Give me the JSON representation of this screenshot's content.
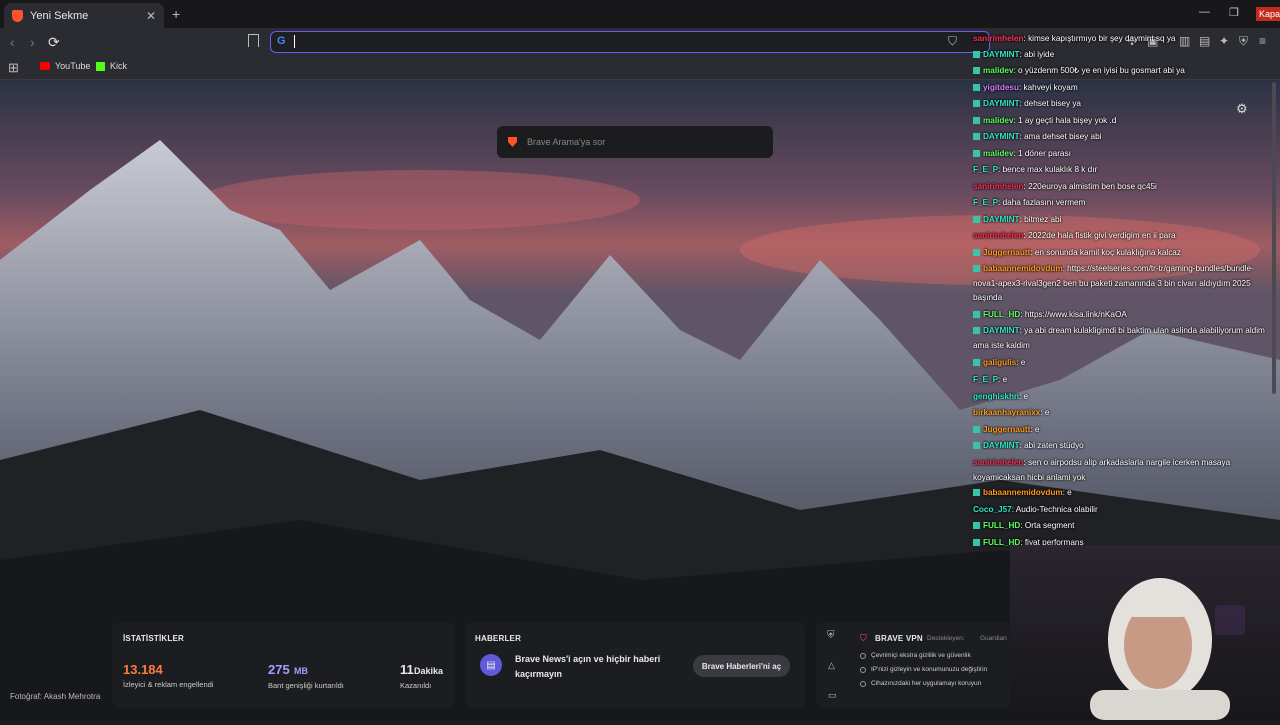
{
  "tab": {
    "title": "Yeni Sekme",
    "close": "✕",
    "new": "+"
  },
  "window": {
    "minimize": "—",
    "maximize": "❐",
    "close_tooltip": "Kapat"
  },
  "toolbar": {
    "back": "‹",
    "forward": "›",
    "reload": "⟳",
    "search_engine_icon": "G",
    "address_value": ""
  },
  "bookmarks": [
    {
      "label": "YouTube"
    },
    {
      "label": "Kick"
    }
  ],
  "search": {
    "placeholder": "Brave Arama'ya sor"
  },
  "photo_credit": "Fotoğraf: Akash Mehrotra",
  "stats": {
    "title": "İSTATİSTİKLER",
    "items": [
      {
        "value": "13.184",
        "unit": "",
        "label": "İzleyici & reklam engellendi",
        "color": "#ff7a3d"
      },
      {
        "value": "275",
        "unit": "MB",
        "label": "Bant genişliği kurtarıldı",
        "color": "#a99cff"
      },
      {
        "value": "11",
        "unit": "Dakika",
        "label": "Kazanıldı",
        "color": "#ffffff"
      }
    ]
  },
  "news": {
    "title": "HABERLER",
    "headline": "Brave News'i açın ve hiçbir haberi kaçırmayın",
    "button": "Brave Haberleri'ni aç"
  },
  "vpn": {
    "title": "BRAVE VPN",
    "supported_by": "Destekleyen:",
    "partner": "Guardian",
    "features": [
      "Çevrimiçi ekstra gizlilik ve güvenlik",
      "IP'nizi gizleyin ve konumunuzu değiştirin",
      "Cihazınızdaki her uygulamayı koruyun"
    ]
  },
  "chat": [
    {
      "user": "sanirimhelen",
      "color": "#ff2d55",
      "text": "kimse kapıştırmıyo bir şey daymint sq ya"
    },
    {
      "user": "DAYMINT",
      "color": "#2ee6c8",
      "text": "abi iyide",
      "badge": true
    },
    {
      "user": "malidev",
      "color": "#5cff5c",
      "text": "o yüzdenm 500₺ ye en iyisi bu gosmart abi ya",
      "badge": true
    },
    {
      "user": "yigitdesu",
      "color": "#d07cff",
      "text": "kahveyi koyam",
      "badge": true
    },
    {
      "user": "DAYMINT",
      "color": "#2ee6c8",
      "text": "dehset bisey ya",
      "badge": true
    },
    {
      "user": "malidev",
      "color": "#5cff5c",
      "text": "1 ay geçti hala bişey yok .d",
      "badge": true
    },
    {
      "user": "DAYMINT",
      "color": "#2ee6c8",
      "text": "ama dehset bisey abi",
      "badge": true
    },
    {
      "user": "malidev",
      "color": "#5cff5c",
      "text": "1 döner parası",
      "badge": true
    },
    {
      "user": "F_E_P",
      "color": "#2ee6c8",
      "text": "bence max kulaklık 8 k dır"
    },
    {
      "user": "sanirimhelen",
      "color": "#ff2d55",
      "text": "220euroya almistim ben bose qc45i"
    },
    {
      "user": "F_E_P",
      "color": "#2ee6c8",
      "text": "daha fazlasını vermem"
    },
    {
      "user": "DAYMINT",
      "color": "#2ee6c8",
      "text": "bitmez abi",
      "badge": true
    },
    {
      "user": "sanirimhelen",
      "color": "#ff2d55",
      "text": "2022de hala fistik givi verdigim en ii para"
    },
    {
      "user": "Juggernautt",
      "color": "#ff9a1f",
      "text": "en sonunda kamil koç kulaklığına kalcaz",
      "badge": true
    },
    {
      "user": "babaannemidovdum",
      "color": "#ff9a1f",
      "text": "https://steelseries.com/tr-tr/gaming-bundles/bundle-nova1-apex3-rival3gen2 ben bu paketi zamanında 3 bin civarı aldıydım 2025 başında",
      "badge": true
    },
    {
      "user": "FULL_HD",
      "color": "#5cff5c",
      "text": "https://www.kisa.link/nKaOA",
      "badge": true
    },
    {
      "user": "DAYMINT",
      "color": "#2ee6c8",
      "text": "ya abi dream kulakligimdi bi baktim ulan aslinda alabiliyorum aldim ama iste kaldim",
      "badge": true
    },
    {
      "user": "galigulis",
      "color": "#ff9a1f",
      "text": "e",
      "badge": true
    },
    {
      "user": "F_E_P",
      "color": "#2ee6c8",
      "text": "e"
    },
    {
      "user": "genghiskhn",
      "color": "#2ee6c8",
      "text": "e"
    },
    {
      "user": "birkaanhayranixx",
      "color": "#ff9a1f",
      "text": "e"
    },
    {
      "user": "Juggernautt",
      "color": "#ff9a1f",
      "text": "e",
      "badge": true
    },
    {
      "user": "DAYMINT",
      "color": "#2ee6c8",
      "text": "abi zaten stüdyo",
      "badge": true
    },
    {
      "user": "sanirimhelen",
      "color": "#ff2d55",
      "text": "sen o airpodsu alip arkadaslarla nargile icerken masaya koyamicaksan hicbi anlami yok"
    },
    {
      "user": "babaannemidovdum",
      "color": "#ff9a1f",
      "text": "e",
      "badge": true
    },
    {
      "user": "Coco_J57",
      "color": "#2ee6c8",
      "text": "Audio-Technica olabilir"
    },
    {
      "user": "FULL_HD",
      "color": "#5cff5c",
      "text": "Orta segment",
      "badge": true
    },
    {
      "user": "FULL_HD",
      "color": "#5cff5c",
      "text": "fiyat performans",
      "badge": true
    }
  ]
}
